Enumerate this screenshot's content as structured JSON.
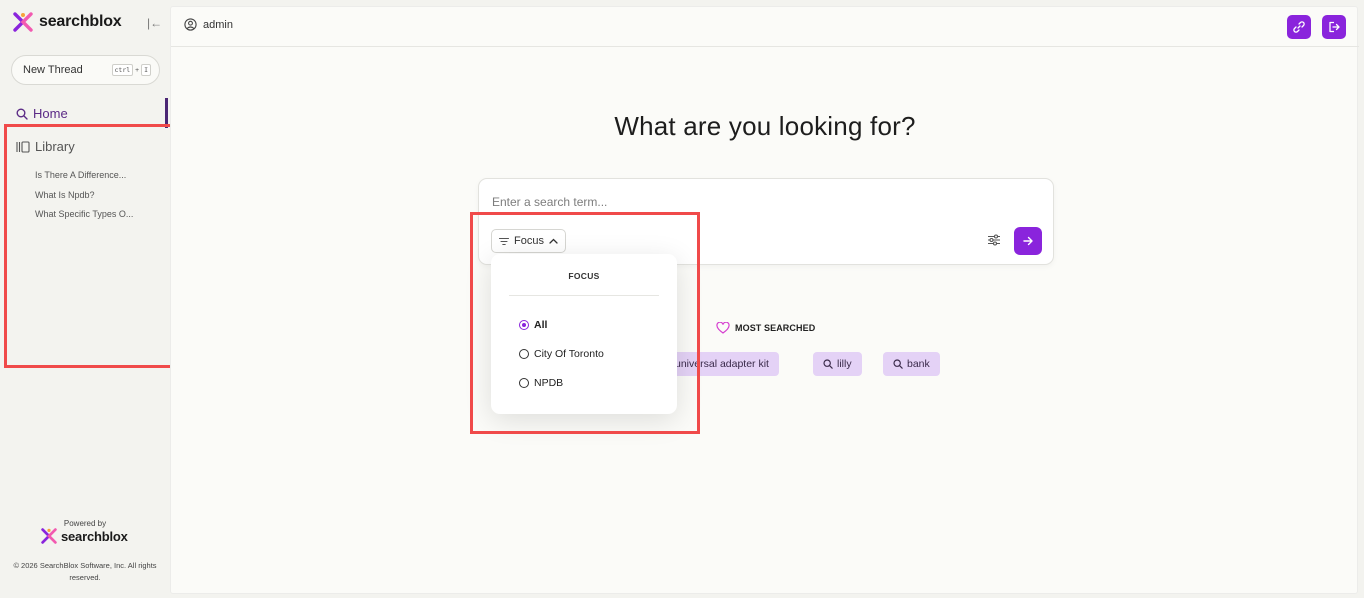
{
  "brand": {
    "name": "searchblox"
  },
  "sidebar": {
    "new_thread": {
      "label": "New Thread",
      "shortcut": [
        "ctrl",
        "+",
        "I"
      ]
    },
    "nav": [
      {
        "label": "Home",
        "icon": "search-icon",
        "active": true
      },
      {
        "label": "Library",
        "icon": "library-icon",
        "active": false
      }
    ],
    "threads": [
      "Is There A Difference...",
      "What Is Npdb?",
      "What Specific Types O..."
    ],
    "footer": {
      "powered_by": "Powered by",
      "brand": "searchblox",
      "copyright": "© 2026 SearchBlox Software, Inc. All rights reserved."
    }
  },
  "topbar": {
    "user": "admin",
    "buttons": [
      {
        "icon": "link-icon"
      },
      {
        "icon": "logout-icon"
      }
    ]
  },
  "main": {
    "headline": "What are you looking for?",
    "search": {
      "placeholder": "Enter a search term...",
      "value": ""
    },
    "focus_button": "Focus",
    "focus_dropdown": {
      "title": "FOCUS",
      "options": [
        {
          "label": "All",
          "selected": true
        },
        {
          "label": "City Of Toronto",
          "selected": false
        },
        {
          "label": "NPDB",
          "selected": false
        }
      ]
    },
    "most_searched": {
      "title": "MOST SEARCHED",
      "chips": [
        "universal adapter kit",
        "lilly",
        "bank"
      ]
    }
  },
  "colors": {
    "accent": "#8a24dc",
    "chip_bg": "#e4d2f6",
    "active_nav": "#5b2a86",
    "highlight": "#f04a4a",
    "heart": "#d63fd0"
  }
}
